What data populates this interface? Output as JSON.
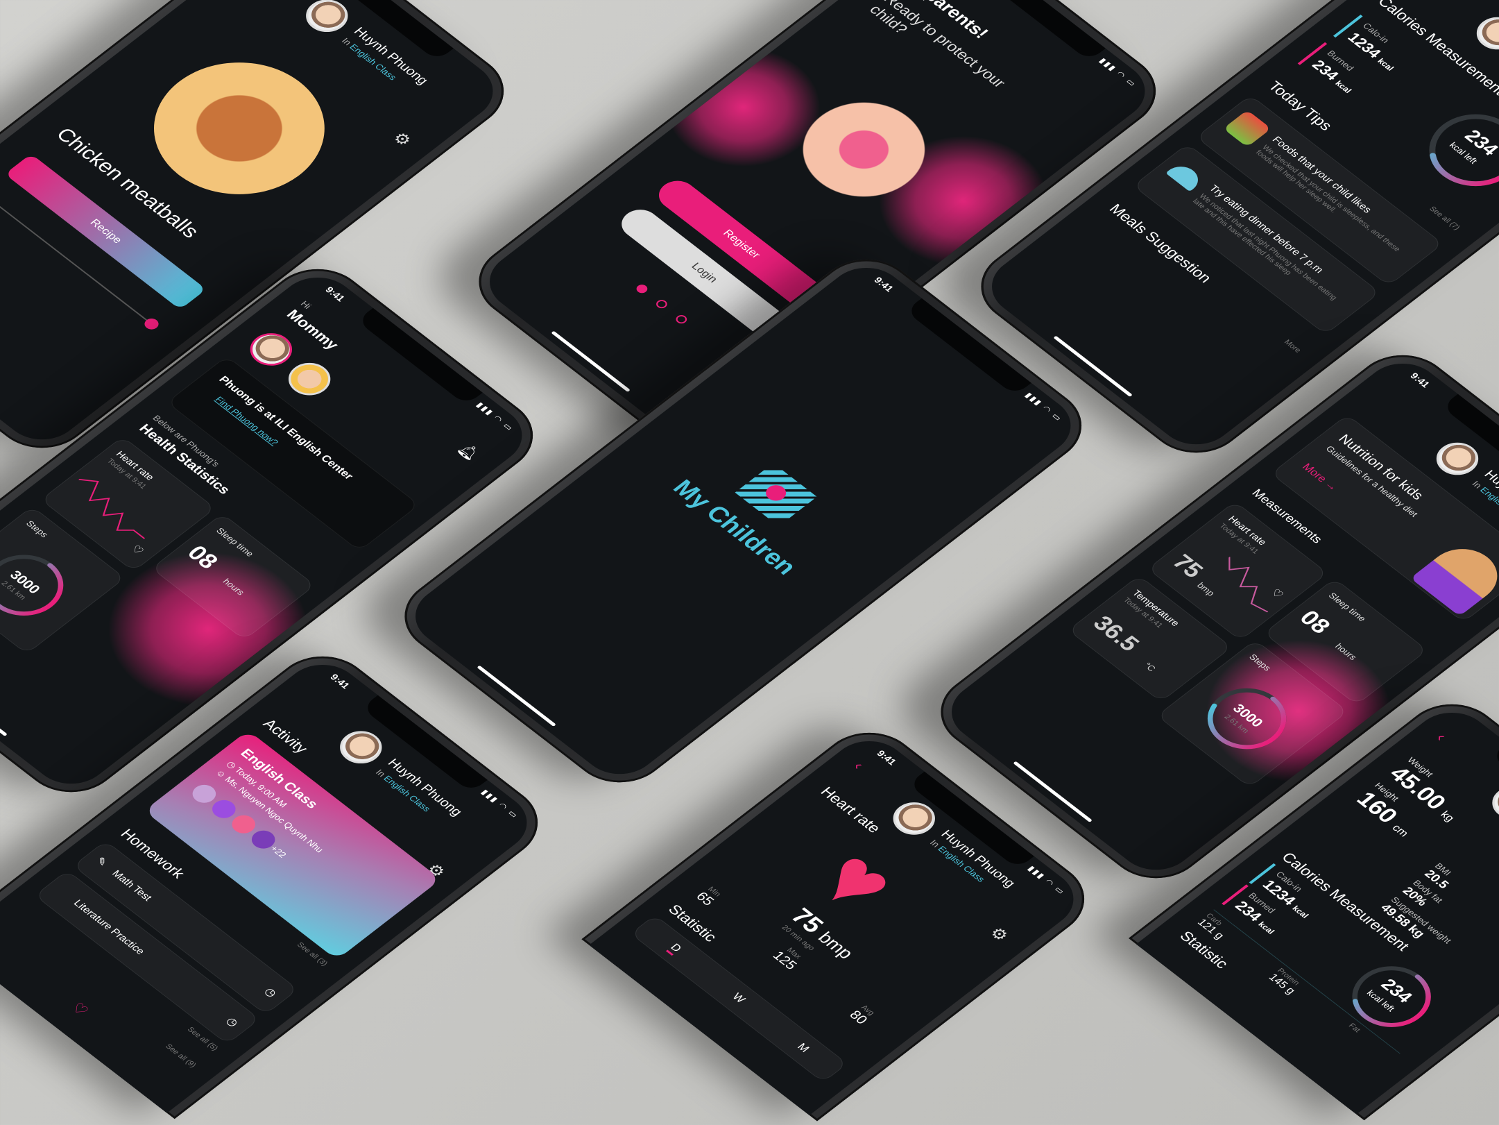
{
  "colors": {
    "accent_pink": "#e91e7a",
    "accent_cyan": "#4cc4dc",
    "background": "#121518",
    "backdrop": "#c8c8c5"
  },
  "common": {
    "time": "9:41",
    "child_name": "Huynh Phuong",
    "in_label": "In",
    "class_name": "English Class",
    "signal": "▮▮▮ ◠ ▭"
  },
  "recipe_screen": {
    "title": "Chicken meatballs",
    "recipe_button": "Recipe"
  },
  "onboarding_screen": {
    "title": "Hi parents!",
    "subtitle": "Ready to protect your child?",
    "register": "Register",
    "login": "Login",
    "page_index": 1,
    "page_count": 3
  },
  "calories_screen": {
    "title": "Calories Measurement",
    "calo_in_label": "Calo-in",
    "calo_in_value": "1234",
    "burned_label": "Burned",
    "burned_value": "234",
    "unit": "kcal",
    "ring_value": "234",
    "ring_label": "kcal left",
    "ring_progress": 0.6,
    "tips_title": "Today Tips",
    "see_all": "See all (7)",
    "tips": [
      {
        "title": "Foods that your child likes",
        "body": "We checked that your child is sleepless, and these foods will help her sleep well."
      },
      {
        "title": "Try eating dinner before 7 p.m",
        "body": "We noticed that last night Phuong has been eating late and this have effected his sleep"
      }
    ],
    "meals_title": "Meals Suggestion",
    "more": "More"
  },
  "home_screen": {
    "greeting": "Hi",
    "parent": "Mommy",
    "location": "Phuong is at ILI English Center",
    "find_link": "Find Phuong now?",
    "intro": "Below are Phuong's",
    "stats_title": "Health Statistics",
    "heart_label": "Heart rate",
    "heart_time": "Today at 9:41",
    "sleep_label": "Sleep time",
    "sleep_value": "08",
    "sleep_unit": "hours",
    "steps_label": "Steps",
    "steps_value": "3000",
    "steps_distance": "2.61 km",
    "steps_progress": 0.7
  },
  "splash_screen": {
    "app_name": "My Children"
  },
  "nutrition_screen": {
    "banner_title": "Nutrition for kids",
    "banner_sub": "Guidelines for a healthy diet",
    "more": "More",
    "section": "Measurements",
    "heart_label": "Heart rate",
    "heart_time": "Today at 9:41",
    "heart_value": "75",
    "heart_unit": "bmp",
    "temp_label": "Temperature",
    "temp_time": "Today at 9:41",
    "temp_value": "36.5",
    "temp_unit": "°C",
    "sleep_label": "Sleep time",
    "sleep_value": "08",
    "sleep_unit": "hours",
    "steps_label": "Steps",
    "steps_value": "3000",
    "steps_distance": "2.61 km"
  },
  "activity_screen": {
    "title": "Activity",
    "class_title": "English Class",
    "class_time": "Today, 9:00 AM",
    "teacher": "Ms. Nguyen Ngoc Quynh Nhu",
    "extra_count": "+22",
    "see_all_activity": "See all (3)",
    "homework_title": "Homework",
    "homework": [
      "Math Test",
      "Literature Practice"
    ],
    "see_all_homework": "See all (5)",
    "see_all_more": "See all (9)"
  },
  "heart_screen": {
    "title": "Heart rate",
    "value": "75",
    "unit": "bmp",
    "ago": "20 min ago",
    "min_label": "Min",
    "min_value": "65",
    "max_label": "Max",
    "max_value": "125",
    "avg_label": "Avg",
    "avg_value": "80",
    "stat_title": "Statistic",
    "tabs": [
      "D",
      "W",
      "M"
    ]
  },
  "body_screen": {
    "weight_label": "Weight",
    "weight_value": "45.00",
    "weight_unit": "kg",
    "height_label": "Height",
    "height_value": "160",
    "height_unit": "cm",
    "bmi_label": "BMI",
    "bmi_value": "20.5",
    "fat_label": "Body fat",
    "fat_value": "20%",
    "suggest_label": "Suggested weight",
    "suggest_value": "49.58 kg",
    "cal_title": "Calories Measurement",
    "calo_in_label": "Calo-in",
    "calo_in_value": "1234",
    "burned_label": "Burned",
    "burned_value": "234",
    "unit": "kcal",
    "carb_label": "Carb",
    "carb_value": "121 g",
    "protein_label": "Protein",
    "protein_value": "145 g",
    "fat2_label": "Fat",
    "ring_value": "234",
    "ring_label": "kcal left",
    "stat_title": "Statistic"
  }
}
